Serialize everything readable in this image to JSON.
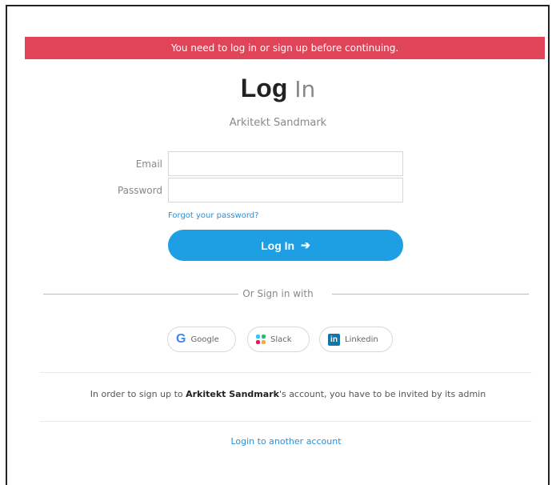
{
  "alert": {
    "message": "You need to log in or sign up before continuing."
  },
  "header": {
    "title_bold": "Log",
    "title_light": "In",
    "organization": "Arkitekt Sandmark"
  },
  "form": {
    "email_label": "Email",
    "email_value": "",
    "password_label": "Password",
    "password_value": "",
    "forgot_link": "Forgot your password?",
    "login_button": "Log In",
    "login_button_icon": "arrow-right-icon"
  },
  "social": {
    "divider_text": "Or Sign in with",
    "providers": [
      {
        "label": "Google",
        "icon": "google-icon"
      },
      {
        "label": "Slack",
        "icon": "slack-icon"
      },
      {
        "label": "Linkedin",
        "icon": "linkedin-icon"
      }
    ]
  },
  "footer": {
    "invite_prefix": "In order to sign up to ",
    "invite_org": "Arkitekt Sandmark",
    "invite_suffix": "'s account, you have to be invited by its admin",
    "another_account_link": "Login to another account"
  },
  "colors": {
    "alert_bg": "#e04459",
    "primary": "#1e9fe3",
    "link": "#2b8fd6"
  }
}
